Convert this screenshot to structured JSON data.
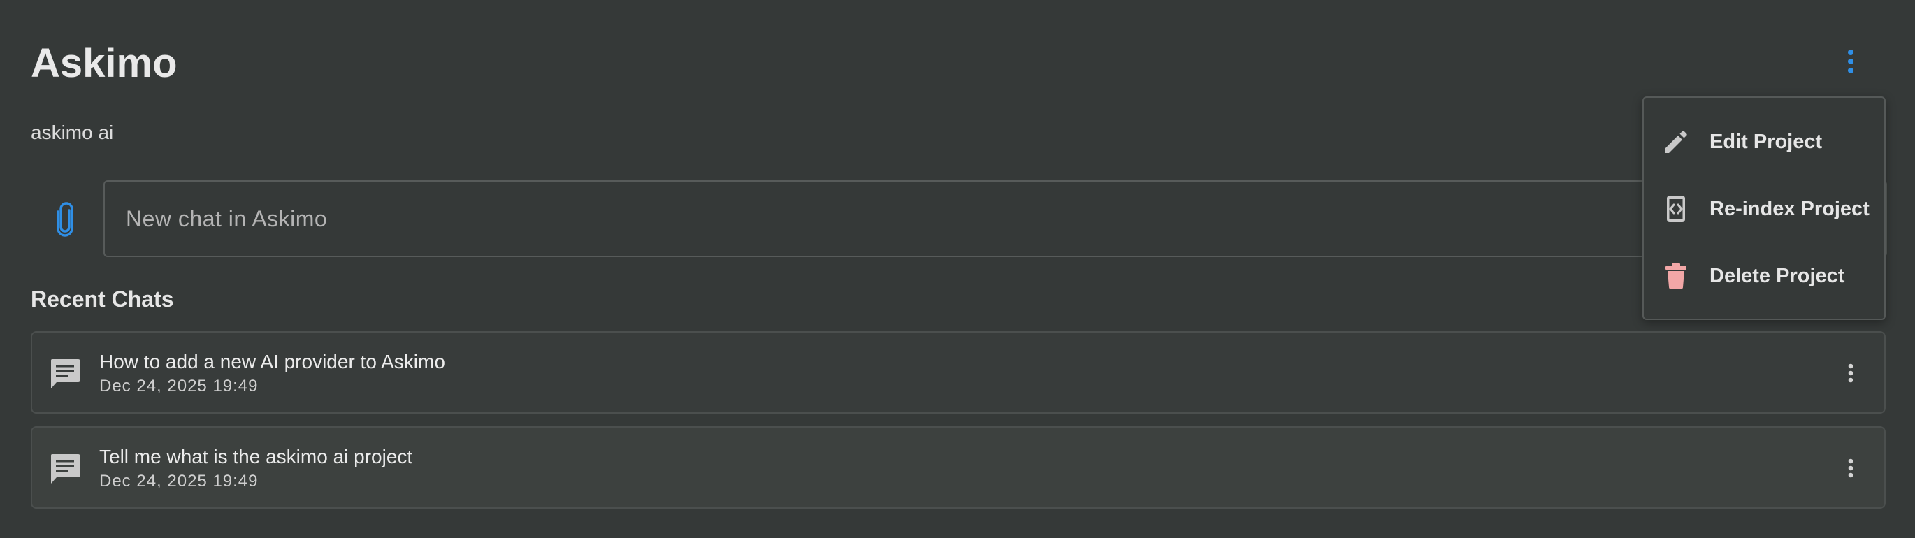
{
  "header": {
    "title": "Askimo",
    "subtitle": "askimo ai"
  },
  "new_chat": {
    "placeholder": "New chat in Askimo"
  },
  "recent": {
    "heading": "Recent Chats",
    "chats": [
      {
        "title": "How to add a new AI provider to Askimo",
        "date": "Dec 24, 2025 19:49"
      },
      {
        "title": "Tell me what is the askimo ai project",
        "date": "Dec 24, 2025 19:49"
      }
    ]
  },
  "project_menu": {
    "items": [
      {
        "label": "Edit Project",
        "icon": "pencil-icon"
      },
      {
        "label": "Re-index Project",
        "icon": "reindex-icon"
      },
      {
        "label": "Delete Project",
        "icon": "trash-icon"
      }
    ]
  },
  "colors": {
    "background": "#353938",
    "accent": "#2f8fe6",
    "danger": "#f2a7a7",
    "icon_gray": "#c9c9c9"
  }
}
